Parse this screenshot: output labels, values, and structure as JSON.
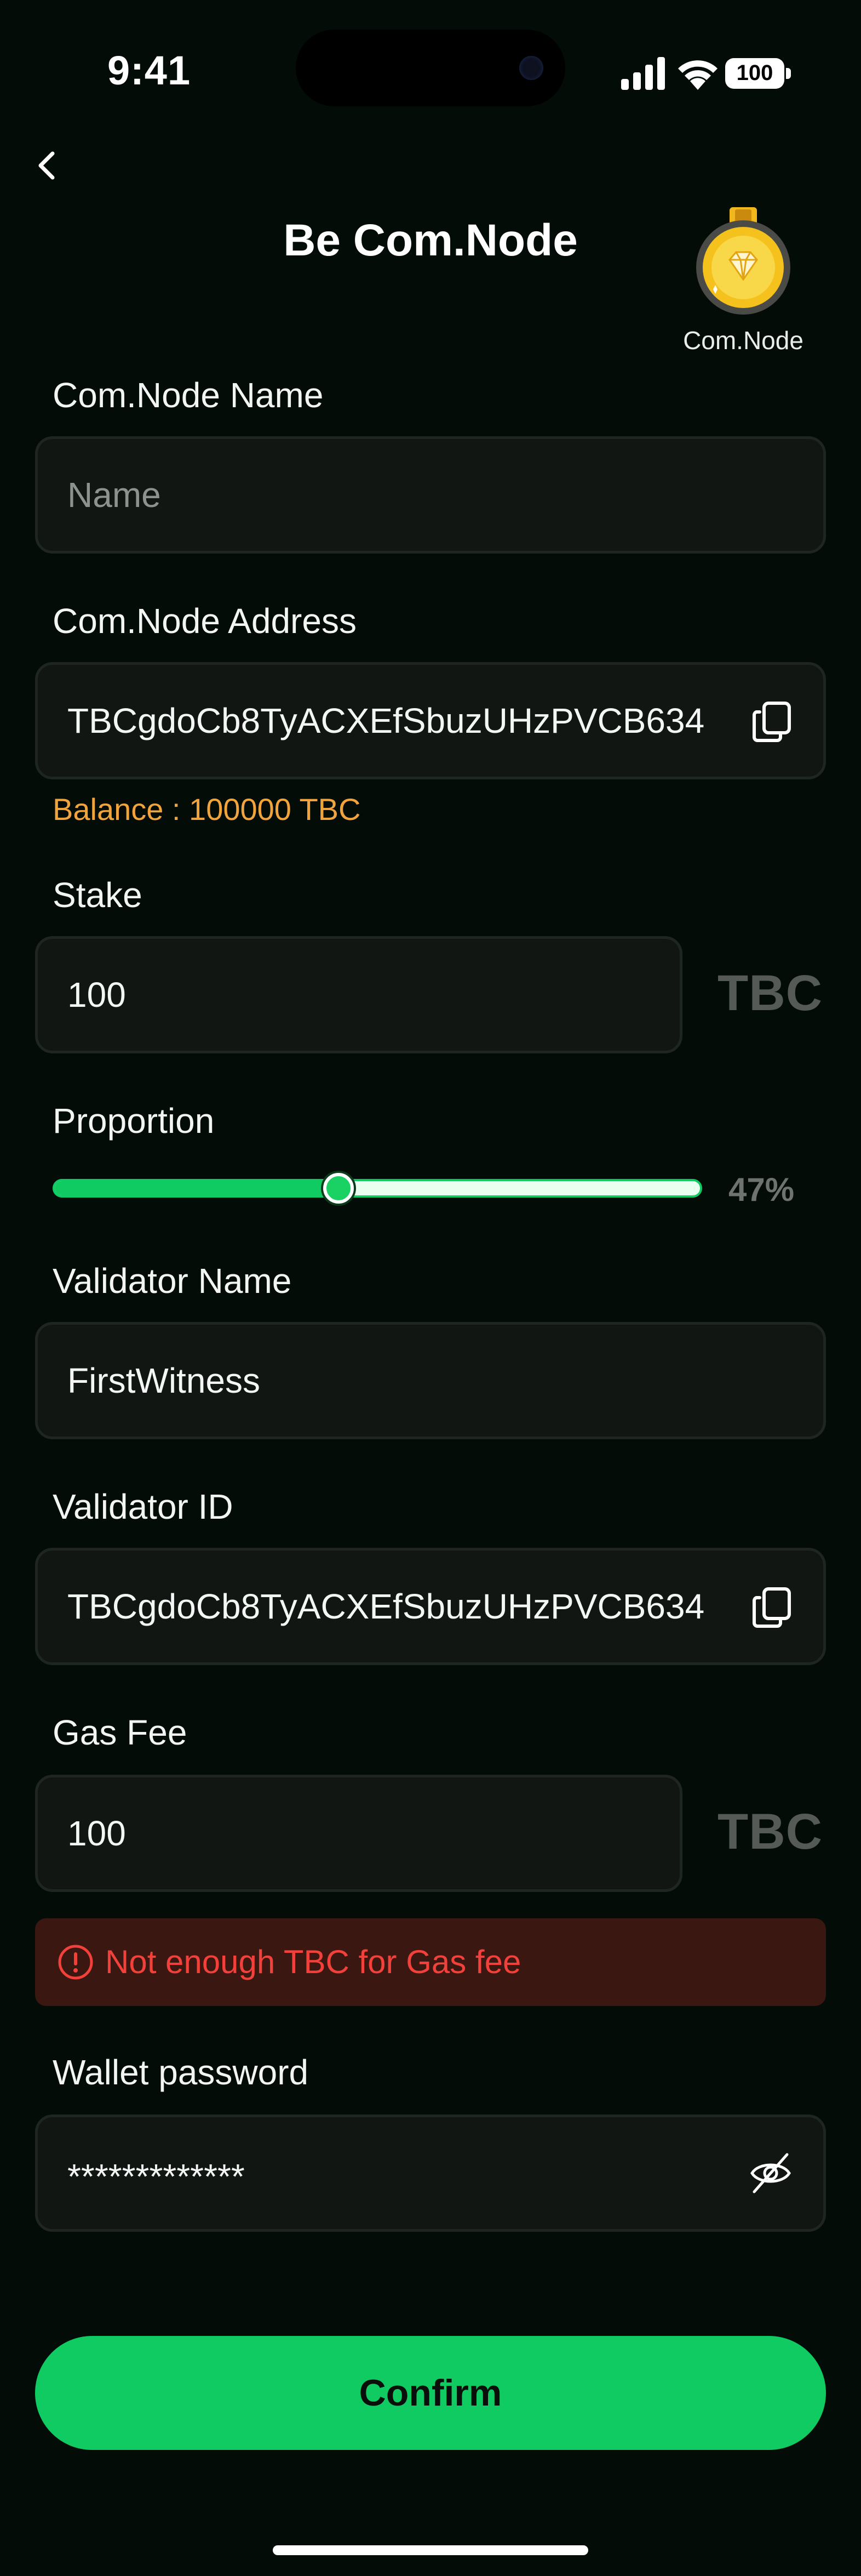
{
  "status_bar": {
    "time": "9:41",
    "battery": "100",
    "icons": [
      "signal-icon",
      "wifi-icon",
      "battery-icon"
    ]
  },
  "header": {
    "title": "Be Com.Node",
    "back_icon": "chevron-left-icon",
    "badge_label": "Com.Node",
    "badge_icon": "diamond-medal-icon"
  },
  "form": {
    "node_name": {
      "label": "Com.Node Name",
      "value": "",
      "placeholder": "Name"
    },
    "node_address": {
      "label": "Com.Node Address",
      "value": "TBCgdoCb8TyACXEfSbuzUHzPVCB634",
      "icon": "copy-icon"
    },
    "balance": "Balance : 100000 TBC",
    "stake": {
      "label": "Stake",
      "value": "100",
      "unit": "TBC"
    },
    "proportion": {
      "label": "Proportion",
      "value_text": "47%",
      "value": 0.44
    },
    "validator_name": {
      "label": "Validator Name",
      "value": "FirstWitness"
    },
    "validator_id": {
      "label": "Validator ID",
      "value": "TBCgdoCb8TyACXEfSbuzUHzPVCB634",
      "icon": "copy-icon"
    },
    "gas_fee": {
      "label": "Gas Fee",
      "value": "100",
      "unit": "TBC"
    },
    "error": {
      "text": "Not enough TBC for Gas fee",
      "icon": "alert-circle-icon"
    },
    "wallet_password": {
      "label": "Wallet password",
      "value": "*************",
      "icon": "eye-off-icon"
    }
  },
  "confirm_label": "Confirm",
  "colors": {
    "background": "#040c07",
    "accent": "#0fcb61",
    "balance": "#f2a43c",
    "error": "#f2413a",
    "error_bg": "#3a1710",
    "field_bg": "#111612"
  }
}
